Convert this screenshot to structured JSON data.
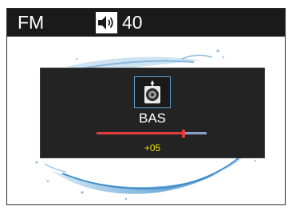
{
  "status_bar": {
    "source": "FM",
    "volume_icon": "speaker-volume-icon",
    "volume": "40"
  },
  "background": {
    "image": "water-splash"
  },
  "overlay": {
    "icon": "speaker-woofer-icon",
    "label": "BAS",
    "value": "+05",
    "slider_level": 0.79
  },
  "colors": {
    "status_bar_bg": "#1a1a1a",
    "overlay_bg": "#232323",
    "icon_frame": "#5fa3d8",
    "slider_track": "#8c9fc8",
    "slider_fill": "#e23b3b",
    "value_text": "#f0e000"
  }
}
